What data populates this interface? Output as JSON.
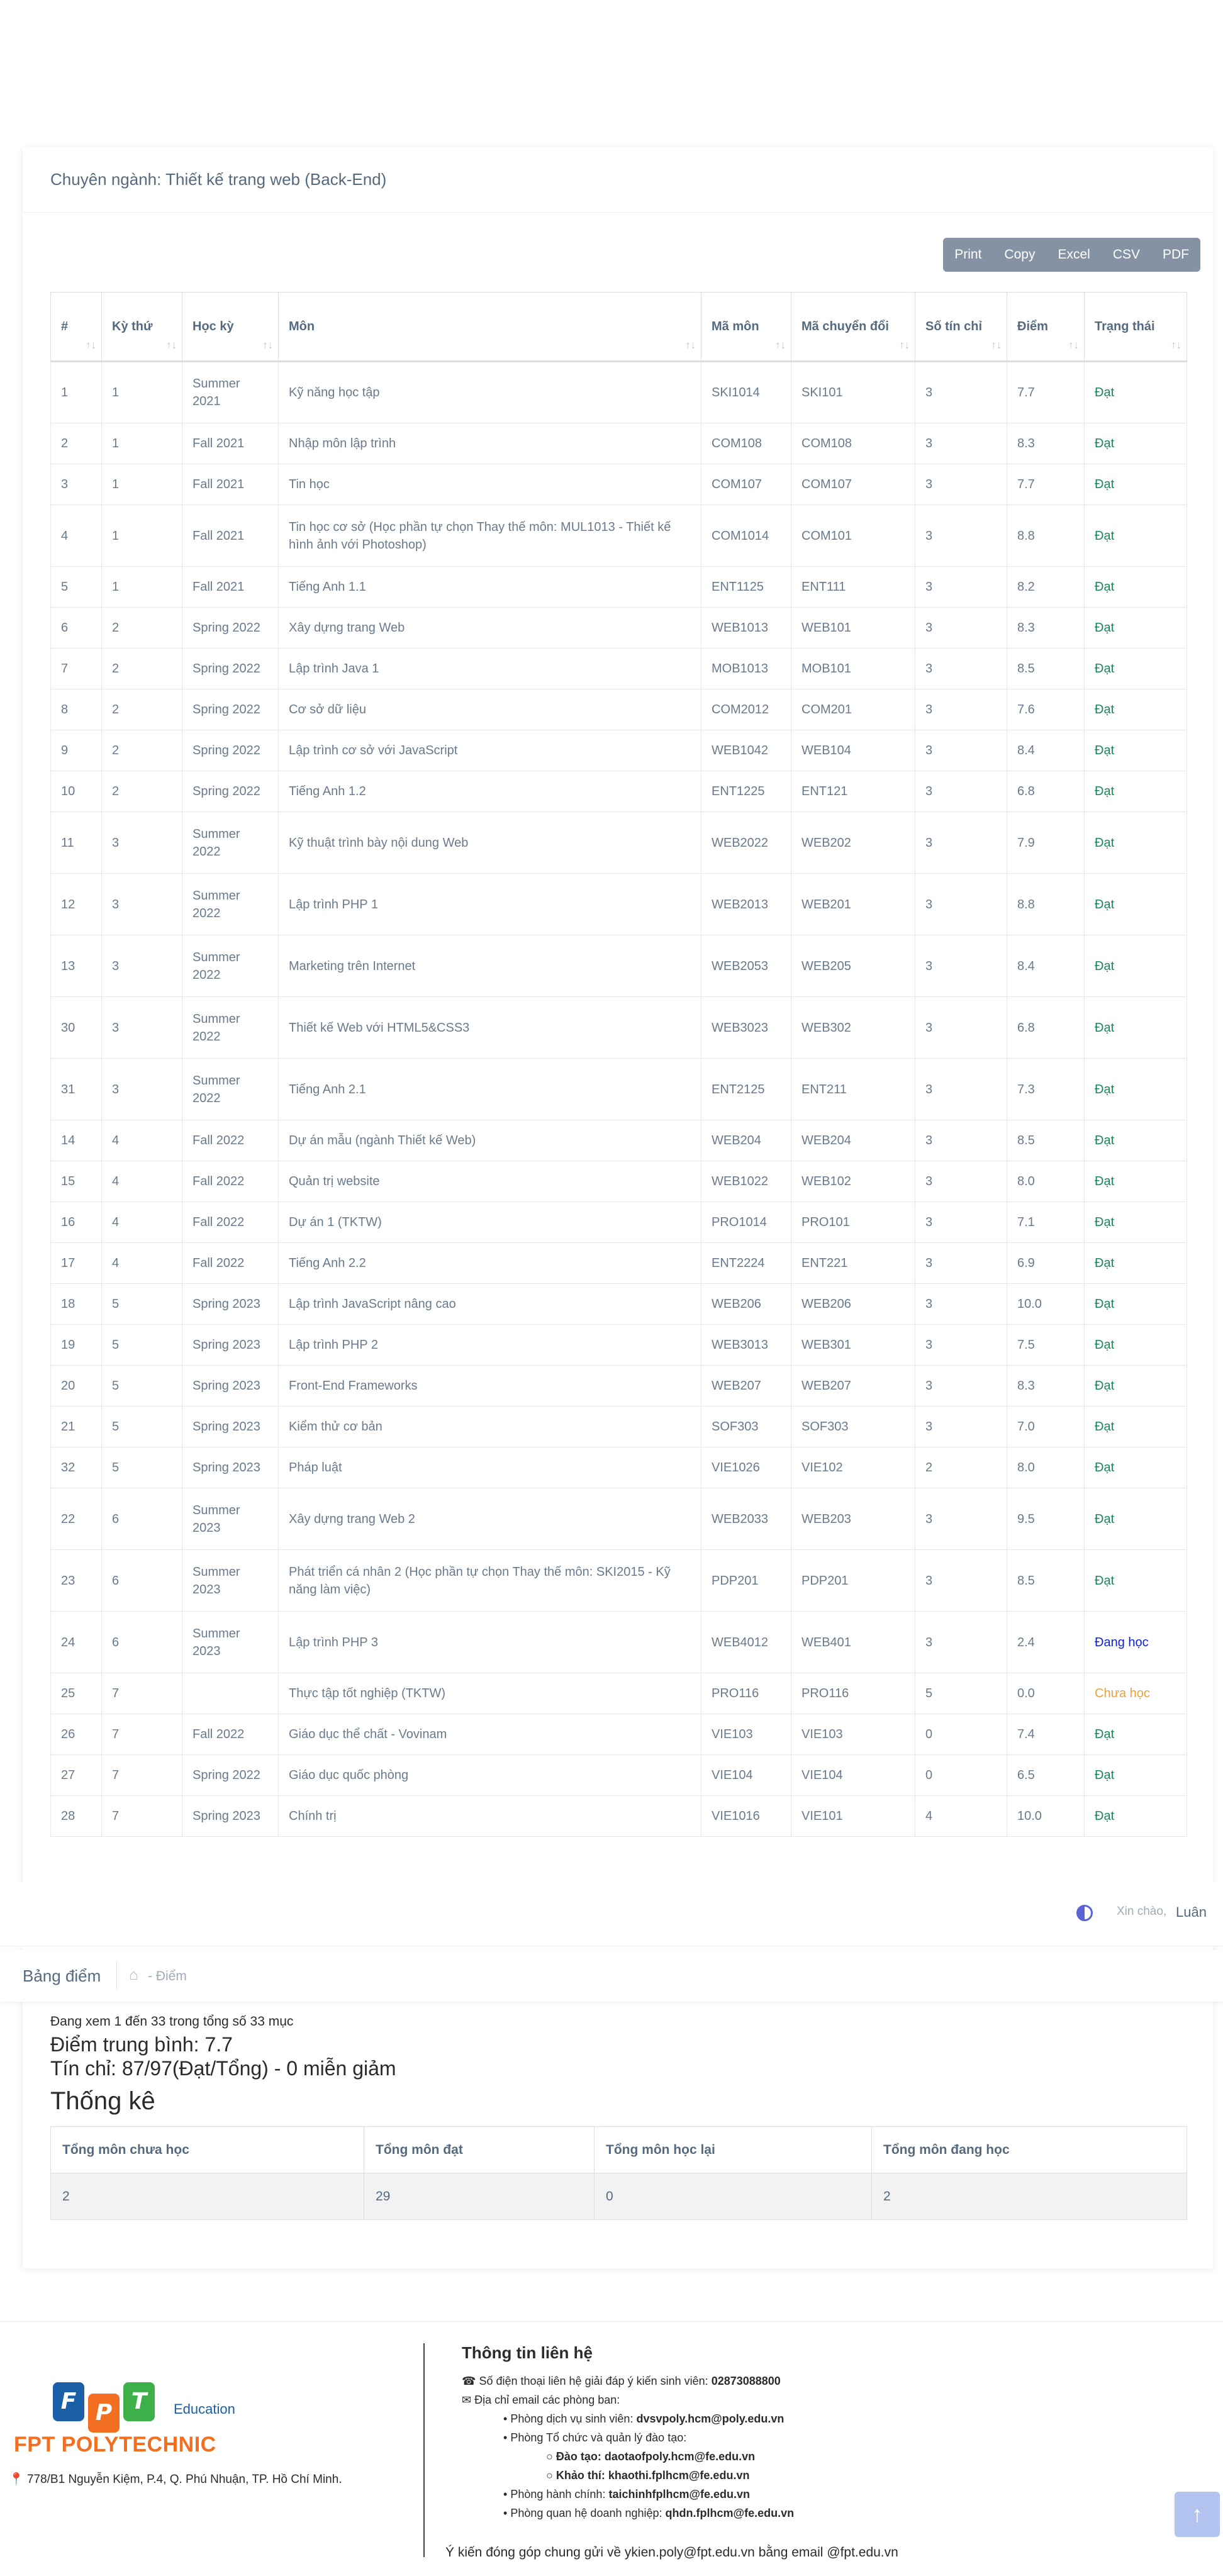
{
  "panel": {
    "title": "Chuyên ngành: Thiết kế trang web (Back-End)"
  },
  "export_buttons": [
    "Print",
    "Copy",
    "Excel",
    "CSV",
    "PDF"
  ],
  "table": {
    "headers": [
      "#",
      "Kỳ thứ",
      "Học kỳ",
      "Môn",
      "Mã môn",
      "Mã chuyển đổi",
      "Số tín chỉ",
      "Điểm",
      "Trạng thái"
    ],
    "rows": [
      [
        "1",
        "1",
        "Summer 2021",
        "Kỹ năng học tập",
        "SKI1014",
        "SKI101",
        "3",
        "7.7",
        "Đạt"
      ],
      [
        "2",
        "1",
        "Fall 2021",
        "Nhập môn lập trình",
        "COM108",
        "COM108",
        "3",
        "8.3",
        "Đạt"
      ],
      [
        "3",
        "1",
        "Fall 2021",
        "Tin học",
        "COM107",
        "COM107",
        "3",
        "7.7",
        "Đạt"
      ],
      [
        "4",
        "1",
        "Fall 2021",
        "Tin học cơ sở (Học phần tự chọn Thay thế môn: MUL1013 - Thiết kế hình ảnh với Photoshop)",
        "COM1014",
        "COM101",
        "3",
        "8.8",
        "Đạt"
      ],
      [
        "5",
        "1",
        "Fall 2021",
        "Tiếng Anh 1.1",
        "ENT1125",
        "ENT111",
        "3",
        "8.2",
        "Đạt"
      ],
      [
        "6",
        "2",
        "Spring 2022",
        "Xây dựng trang Web",
        "WEB1013",
        "WEB101",
        "3",
        "8.3",
        "Đạt"
      ],
      [
        "7",
        "2",
        "Spring 2022",
        "Lập trình Java 1",
        "MOB1013",
        "MOB101",
        "3",
        "8.5",
        "Đạt"
      ],
      [
        "8",
        "2",
        "Spring 2022",
        "Cơ sở dữ liệu",
        "COM2012",
        "COM201",
        "3",
        "7.6",
        "Đạt"
      ],
      [
        "9",
        "2",
        "Spring 2022",
        "Lập trình cơ sở với JavaScript",
        "WEB1042",
        "WEB104",
        "3",
        "8.4",
        "Đạt"
      ],
      [
        "10",
        "2",
        "Spring 2022",
        "Tiếng Anh 1.2",
        "ENT1225",
        "ENT121",
        "3",
        "6.8",
        "Đạt"
      ],
      [
        "11",
        "3",
        "Summer 2022",
        "Kỹ thuật trình bày nội dung Web",
        "WEB2022",
        "WEB202",
        "3",
        "7.9",
        "Đạt"
      ],
      [
        "12",
        "3",
        "Summer 2022",
        "Lập trình PHP 1",
        "WEB2013",
        "WEB201",
        "3",
        "8.8",
        "Đạt"
      ],
      [
        "13",
        "3",
        "Summer 2022",
        "Marketing trên Internet",
        "WEB2053",
        "WEB205",
        "3",
        "8.4",
        "Đạt"
      ],
      [
        "30",
        "3",
        "Summer 2022",
        "Thiết kế Web với HTML5&CSS3",
        "WEB3023",
        "WEB302",
        "3",
        "6.8",
        "Đạt"
      ],
      [
        "31",
        "3",
        "Summer 2022",
        "Tiếng Anh 2.1",
        "ENT2125",
        "ENT211",
        "3",
        "7.3",
        "Đạt"
      ],
      [
        "14",
        "4",
        "Fall 2022",
        "Dự án mẫu (ngành Thiết kế Web)",
        "WEB204",
        "WEB204",
        "3",
        "8.5",
        "Đạt"
      ],
      [
        "15",
        "4",
        "Fall 2022",
        "Quản trị website",
        "WEB1022",
        "WEB102",
        "3",
        "8.0",
        "Đạt"
      ],
      [
        "16",
        "4",
        "Fall 2022",
        "Dự án 1 (TKTW)",
        "PRO1014",
        "PRO101",
        "3",
        "7.1",
        "Đạt"
      ],
      [
        "17",
        "4",
        "Fall 2022",
        "Tiếng Anh 2.2",
        "ENT2224",
        "ENT221",
        "3",
        "6.9",
        "Đạt"
      ],
      [
        "18",
        "5",
        "Spring 2023",
        "Lập trình JavaScript nâng cao",
        "WEB206",
        "WEB206",
        "3",
        "10.0",
        "Đạt"
      ],
      [
        "19",
        "5",
        "Spring 2023",
        "Lập trình PHP 2",
        "WEB3013",
        "WEB301",
        "3",
        "7.5",
        "Đạt"
      ],
      [
        "20",
        "5",
        "Spring 2023",
        "Front-End Frameworks",
        "WEB207",
        "WEB207",
        "3",
        "8.3",
        "Đạt"
      ],
      [
        "21",
        "5",
        "Spring 2023",
        "Kiểm thử cơ bản",
        "SOF303",
        "SOF303",
        "3",
        "7.0",
        "Đạt"
      ],
      [
        "32",
        "5",
        "Spring 2023",
        "Pháp luật",
        "VIE1026",
        "VIE102",
        "2",
        "8.0",
        "Đạt"
      ],
      [
        "22",
        "6",
        "Summer 2023",
        "Xây dựng trang Web 2",
        "WEB2033",
        "WEB203",
        "3",
        "9.5",
        "Đạt"
      ],
      [
        "23",
        "6",
        "Summer 2023",
        "Phát triển cá nhân 2 (Học phần tự chọn Thay thế môn: SKI2015 - Kỹ năng làm việc)",
        "PDP201",
        "PDP201",
        "3",
        "8.5",
        "Đạt"
      ],
      [
        "24",
        "6",
        "Summer 2023",
        "Lập trình PHP 3",
        "WEB4012",
        "WEB401",
        "3",
        "2.4",
        "Đang học"
      ],
      [
        "25",
        "7",
        "",
        "Thực tập tốt nghiệp (TKTW)",
        "PRO116",
        "PRO116",
        "5",
        "0.0",
        "Chưa học"
      ],
      [
        "26",
        "7",
        "Fall 2022",
        "Giáo dục thể chất - Vovinam",
        "VIE103",
        "VIE103",
        "0",
        "7.4",
        "Đạt"
      ],
      [
        "27",
        "7",
        "Spring 2022",
        "Giáo dục quốc phòng",
        "VIE104",
        "VIE104",
        "0",
        "6.5",
        "Đạt"
      ],
      [
        "28",
        "7",
        "Spring 2023",
        "Chính trị",
        "VIE1016",
        "VIE101",
        "4",
        "10.0",
        "Đạt"
      ]
    ],
    "status_colors": {
      "Đạt": "#198754",
      "Đang học": "#0d1fd6",
      "Chưa học": "#e9a23b"
    }
  },
  "navbar": {
    "greeting": "Xin chào,",
    "user_name": "Luân"
  },
  "breadcrumb": {
    "title": "Bảng điểm",
    "current": "Điểm"
  },
  "summary": {
    "showing": "Đang xem 1 đến 33 trong tổng số 33 mục",
    "average": "Điểm trung bình: 7.7",
    "credits": "Tín chỉ: 87/97(Đạt/Tổng) - 0 miễn giảm",
    "stats_title": "Thống kê"
  },
  "stats": {
    "headers": [
      "Tổng môn chưa học",
      "Tổng môn đạt",
      "Tổng môn học lại",
      "Tổng môn đang học"
    ],
    "values": [
      "2",
      "29",
      "0",
      "2"
    ]
  },
  "footer": {
    "logo_letters": [
      "F",
      "P",
      "T"
    ],
    "logo_edu": "Education",
    "brand": "FPT POLYTECHNIC",
    "address": "778/B1 Nguyễn Kiệm, P.4, Q. Phú Nhuận, TP. Hồ Chí Minh.",
    "contact_title": "Thông tin liên hệ",
    "phone_label": "Số điện thoại liên hệ giải đáp ý kiến sinh viên: ",
    "phone": "02873088800",
    "email_intro": "Địa chỉ email các phòng ban:",
    "dept_service_label": "Phòng dịch vụ sinh viên: ",
    "dept_service_email": "dvsvpoly.hcm@poly.edu.vn",
    "dept_training_label": "Phòng Tổ chức và quản lý đào tạo:",
    "training_label": "Đào tạo: ",
    "training_email": "daotaofpoly.hcm@fe.edu.vn",
    "exam_label": "Khảo thí: ",
    "exam_email": "khaothi.fplhcm@fe.edu.vn",
    "admin_label": "Phòng hành chính: ",
    "admin_email": "taichinhfplhcm@fe.edu.vn",
    "business_label": "Phòng quan hệ doanh nghiệp: ",
    "business_email": "qhdn.fplhcm@fe.edu.vn",
    "feedback": "Ý kiến đóng góp chung gửi về ykien.poly@fpt.edu.vn bằng email @fpt.edu.vn"
  }
}
